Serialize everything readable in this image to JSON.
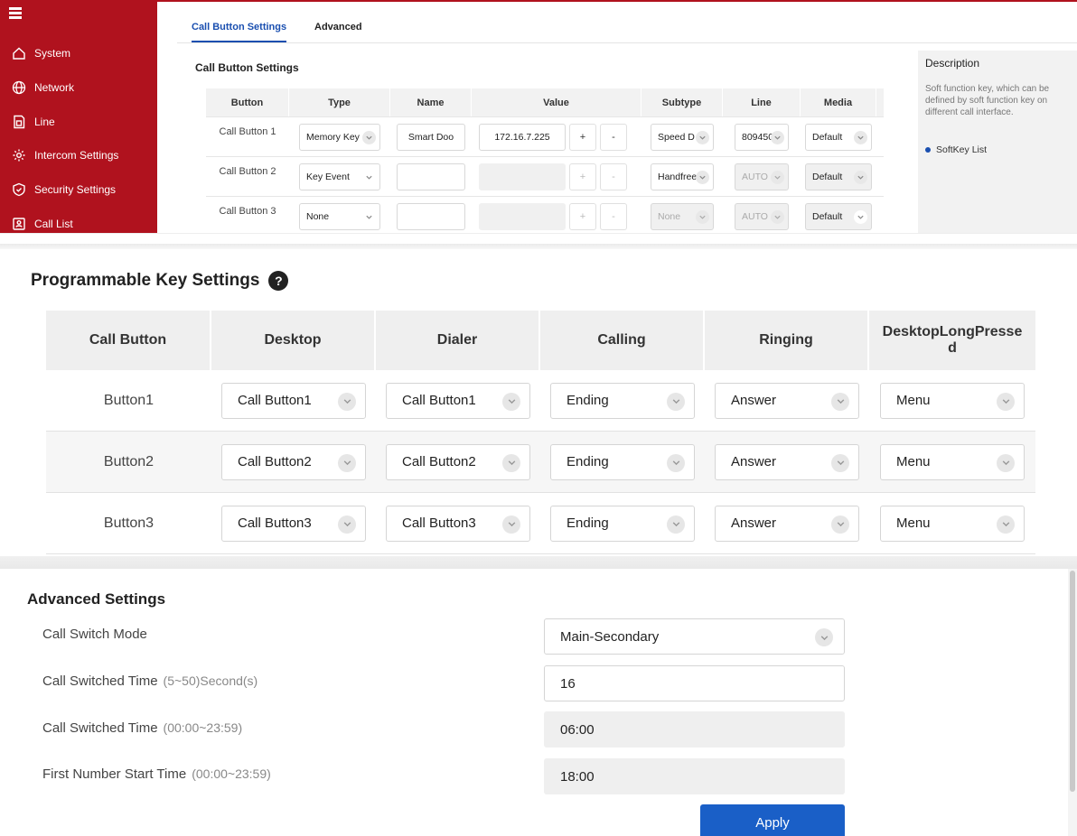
{
  "sidebar": {
    "items": [
      {
        "label": "System",
        "icon": "home-icon"
      },
      {
        "label": "Network",
        "icon": "globe-icon"
      },
      {
        "label": "Line",
        "icon": "sim-card-icon"
      },
      {
        "label": "Intercom Settings",
        "icon": "gear-icon"
      },
      {
        "label": "Security Settings",
        "icon": "shield-icon"
      },
      {
        "label": "Call List",
        "icon": "contact-card-icon"
      }
    ]
  },
  "tabs": [
    {
      "label": "Call Button Settings",
      "active": true
    },
    {
      "label": "Advanced",
      "active": false
    }
  ],
  "call_button_settings": {
    "title": "Call Button Settings",
    "columns": [
      "Button",
      "Type",
      "Name",
      "Value",
      "Subtype",
      "Line",
      "Media"
    ],
    "rows": [
      {
        "button": "Call Button 1",
        "type": "Memory Key",
        "name": "Smart Doo",
        "value": "172.16.7.225",
        "plus": "+",
        "minus": "-",
        "subtype": "Speed D",
        "line": "809450",
        "media": "Default"
      },
      {
        "button": "Call Button 2",
        "type": "Key Event",
        "name": "",
        "value": "",
        "plus": "+",
        "minus": "-",
        "subtype": "Handfree",
        "line": "AUTO",
        "media": "Default"
      },
      {
        "button": "Call Button 3",
        "type": "None",
        "name": "",
        "value": "",
        "plus": "+",
        "minus": "-",
        "subtype": "None",
        "line": "AUTO",
        "media": "Default"
      }
    ]
  },
  "description": {
    "title": "Description",
    "text": "Soft function key, which can be defined by soft function key on different call interface.",
    "link": "SoftKey List"
  },
  "programmable_keys": {
    "title": "Programmable Key Settings",
    "help_glyph": "?",
    "columns": [
      "Call Button",
      "Desktop",
      "Dialer",
      "Calling",
      "Ringing",
      "DesktopLongPressed"
    ],
    "rows": [
      {
        "button": "Button1",
        "desktop": "Call Button1",
        "dialer": "Call Button1",
        "calling": "Ending",
        "ringing": "Answer",
        "long_pressed": "Menu"
      },
      {
        "button": "Button2",
        "desktop": "Call Button2",
        "dialer": "Call Button2",
        "calling": "Ending",
        "ringing": "Answer",
        "long_pressed": "Menu"
      },
      {
        "button": "Button3",
        "desktop": "Call Button3",
        "dialer": "Call Button3",
        "calling": "Ending",
        "ringing": "Answer",
        "long_pressed": "Menu"
      }
    ]
  },
  "advanced": {
    "title": "Advanced Settings",
    "fields": [
      {
        "label": "Call Switch Mode",
        "hint": "",
        "value": "Main-Secondary"
      },
      {
        "label": "Call Switched Time",
        "hint": "(5~50)Second(s)",
        "value": "16"
      },
      {
        "label": "Call Switched Time",
        "hint": "(00:00~23:59)",
        "value": "06:00"
      },
      {
        "label": "First Number Start Time",
        "hint": "(00:00~23:59)",
        "value": "18:00"
      }
    ],
    "apply_label": "Apply"
  },
  "colors": {
    "brand_red": "#b0121e",
    "accent_blue": "#1a5fc7"
  }
}
